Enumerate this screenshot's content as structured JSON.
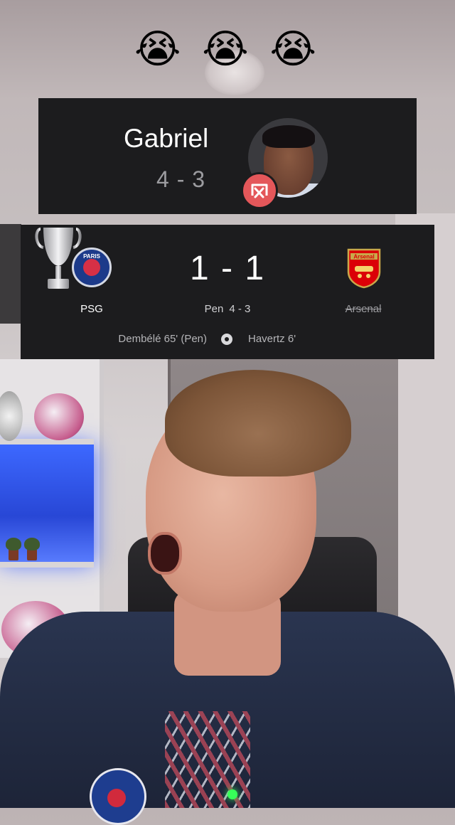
{
  "reaction": {
    "emojis": [
      "😭",
      "😭",
      "😭"
    ]
  },
  "penalty_taker": {
    "name": "Gabriel",
    "shootout_score": "4 - 3",
    "outcome_icon": "missed-penalty-icon"
  },
  "match": {
    "home_team": "PSG",
    "away_team": "Arsenal",
    "score": "1 - 1",
    "penalties_label": "Pen",
    "penalties_score": "4 - 3",
    "home_scorers": "Dembélé 65' (Pen)",
    "away_scorers": "Havertz 6'",
    "competition_icon": "champions-league-trophy-icon",
    "home_crest_text": "PARIS",
    "away_crest_text": "Arsenal",
    "colors": {
      "card": "#1c1c1e",
      "miss_badge": "#e4575a",
      "psg_blue": "#1c3a8a",
      "arsenal_red": "#db0007"
    }
  }
}
